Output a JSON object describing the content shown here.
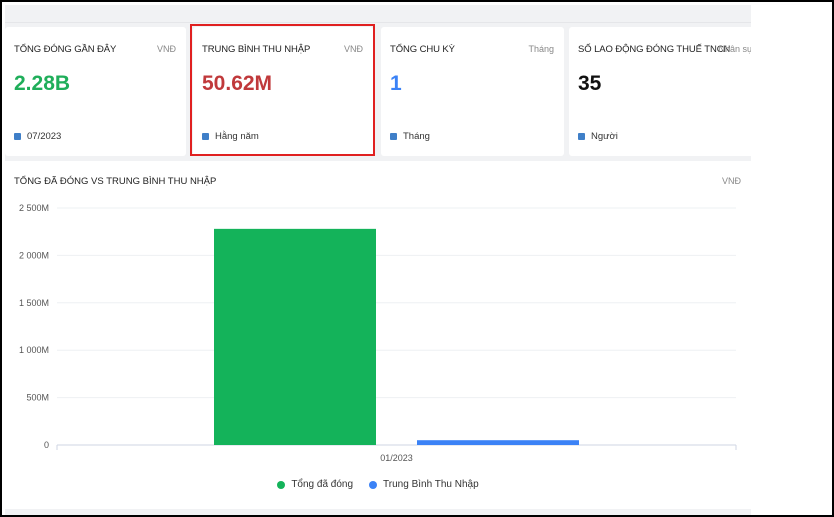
{
  "cards": [
    {
      "title": "TỔNG ĐÓNG GẦN ĐÂY",
      "unit": "VNĐ",
      "value": "2.28B",
      "value_color": "#1fae5a",
      "foot": "07/2023"
    },
    {
      "title": "TRUNG BÌNH THU NHẬP",
      "unit": "VNĐ",
      "value": "50.62M",
      "value_color": "#c0393b",
      "foot": "Hằng năm"
    },
    {
      "title": "TỔNG CHU KỲ",
      "unit": "Tháng",
      "value": "1",
      "value_color": "#3b82f6",
      "foot": "Tháng"
    },
    {
      "title": "SỐ LAO ĐỘNG ĐÓNG THUẾ TNCN",
      "unit": "Nhân sự",
      "value": "35",
      "value_color": "#111111",
      "foot": "Người"
    }
  ],
  "chart": {
    "title": "TỔNG ĐÃ ĐÓNG VS TRUNG BÌNH THU NHẬP",
    "unit": "VNĐ"
  },
  "chart_data": {
    "type": "bar",
    "categories": [
      "01/2023"
    ],
    "series": [
      {
        "name": "Tổng đã đóng",
        "values": [
          2280
        ],
        "color": "#14b35a"
      },
      {
        "name": "Trung Bình Thu Nhập",
        "values": [
          50.62
        ],
        "color": "#3b82f6"
      }
    ],
    "ylim": [
      0,
      2500
    ],
    "yticks": [
      0,
      500,
      1000,
      1500,
      2000,
      2500
    ],
    "ytick_labels": [
      "0",
      "500M",
      "1 000M",
      "1 500M",
      "2 000M",
      "2 500M"
    ],
    "grid": true,
    "legend": "bottom"
  }
}
